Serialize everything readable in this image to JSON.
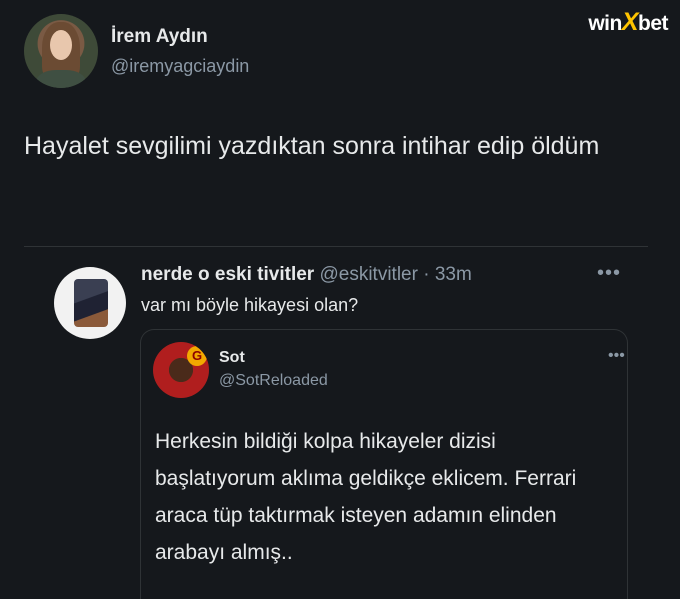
{
  "tweet": {
    "display_name": "İrem Aydın",
    "handle": "@iremyagciaydin",
    "text": "Hayalet sevgilimi yazdıktan sonra intihar edip öldüm"
  },
  "watermark": {
    "left": "win",
    "mid": "X",
    "right": "bet"
  },
  "quoted": {
    "display_name": "nerde o eski tivitler",
    "meta": "@eskitvitler · 33m",
    "more": "•••",
    "text": "var mı böyle hikayesi olan?",
    "embedded": {
      "display_name": "Sot",
      "handle": "@SotReloaded",
      "more": "•••",
      "badge": "G",
      "text": "Herkesin bildiği kolpa hikayeler dizisi başlatıyorum aklıma geldikçe eklicem. Ferrari araca tüp taktırmak isteyen adamın elinden arabayı almış.."
    }
  }
}
